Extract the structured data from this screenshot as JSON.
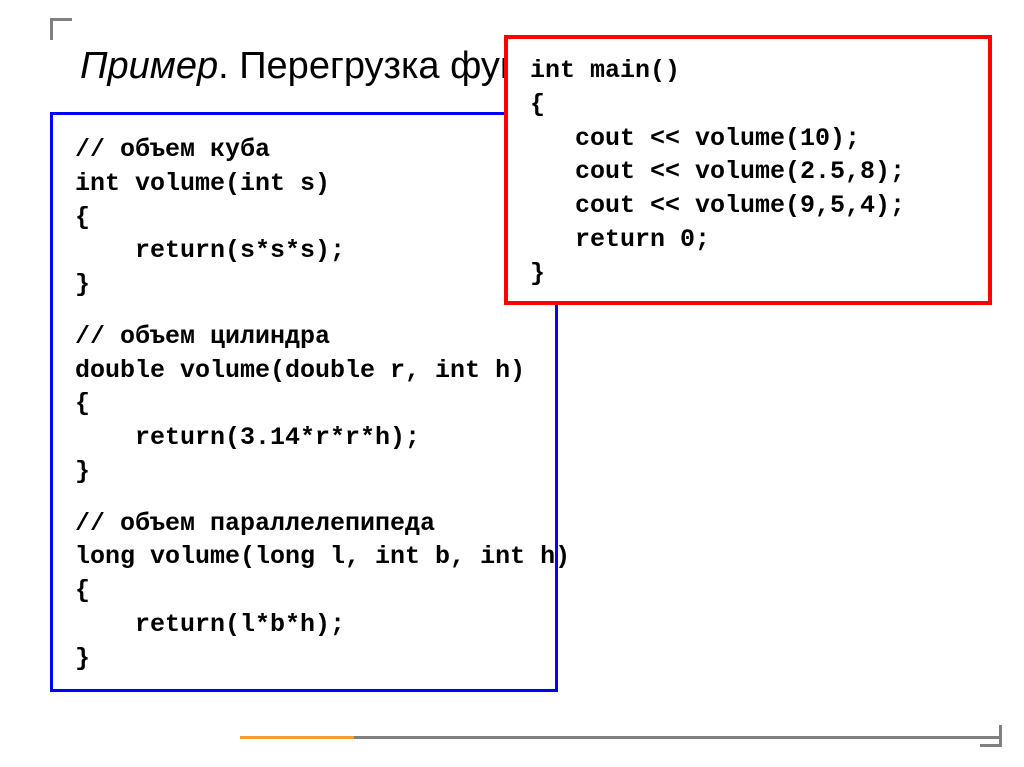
{
  "title": {
    "italic_word": "Пример",
    "regular_text": ". Перегрузка функц"
  },
  "red_box": {
    "line1": "int main()",
    "line2": "{",
    "line3": "   cout << volume(10);",
    "line4": "   cout << volume(2.5,8);",
    "line5": "   cout << volume(9,5,4);",
    "line6": "   return 0;",
    "line7": "}"
  },
  "blue_box": {
    "block1": {
      "comment": "// объем куба",
      "signature": "int volume(int s)",
      "open": "{",
      "body": "    return(s*s*s);",
      "close": "}"
    },
    "block2": {
      "comment": "// объем цилиндра",
      "signature": "double volume(double r, int h)",
      "open": "{",
      "body": "    return(3.14*r*r*h);",
      "close": "}"
    },
    "block3": {
      "comment": "// объем параллелепипеда",
      "signature": "long volume(long l, int b, int h)",
      "open": "{",
      "body": "    return(l*b*h);",
      "close": "}"
    }
  }
}
